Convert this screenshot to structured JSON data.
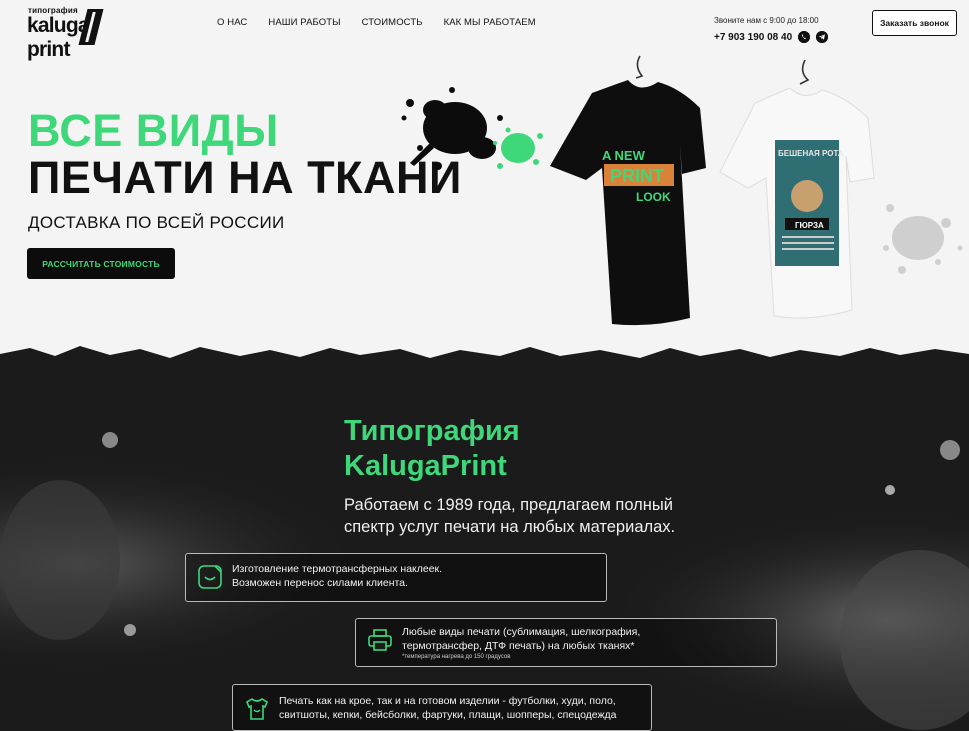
{
  "logo": {
    "small": "типография",
    "big": "kaluga",
    "big2": "print"
  },
  "nav": [
    "О НАС",
    "НАШИ РАБОТЫ",
    "СТОИМОСТЬ",
    "КАК МЫ РАБОТАЕМ"
  ],
  "contact": {
    "hours": "Звоните нам с 9:00 до 18:00",
    "phone": "+7 903 190 08 40"
  },
  "call_button": "Заказать звонок",
  "hero": {
    "line1": "ВСЕ ВИДЫ",
    "line2": "ПЕЧАТИ НА ТКАНИ",
    "subtitle": "ДОСТАВКА ПО ВСЕЙ РОССИИ",
    "button": "РАССЧИТАТЬ СТОИМОСТЬ",
    "shirt1_text": [
      "A NEW",
      "PRINT",
      "LOOK"
    ],
    "shirt2_text": [
      "БЕШЕНАЯ РОТА",
      "ГЮРЗА"
    ]
  },
  "about": {
    "title": "Типография KalugaPrint",
    "text": "Работаем с 1989 года, предлагаем полный спектр услуг печати на любых материалах."
  },
  "features": [
    {
      "icon": "sticker-icon",
      "line1": "Изготовление термотрансферных наклеек.",
      "line2": "Возможен перенос силами клиента.",
      "note": ""
    },
    {
      "icon": "printer-icon",
      "line1": "Любые виды печати (сублимация, шелкография,",
      "line2": "термотрансфер, ДТФ печать) на любых тканях*",
      "note": "*температура нагрева до 150 градусов"
    },
    {
      "icon": "tshirt-icon",
      "line1": "Печать как на крое, так и на готовом изделии - футболки, худи, поло,",
      "line2": "свитшоты, кепки, бейсболки, фартуки, плащи, шопперы, спецодежда",
      "note": ""
    }
  ],
  "colors": {
    "accent": "#3ed87b",
    "dark": "#0c0c0c",
    "light_bg": "#f4f4f4"
  }
}
